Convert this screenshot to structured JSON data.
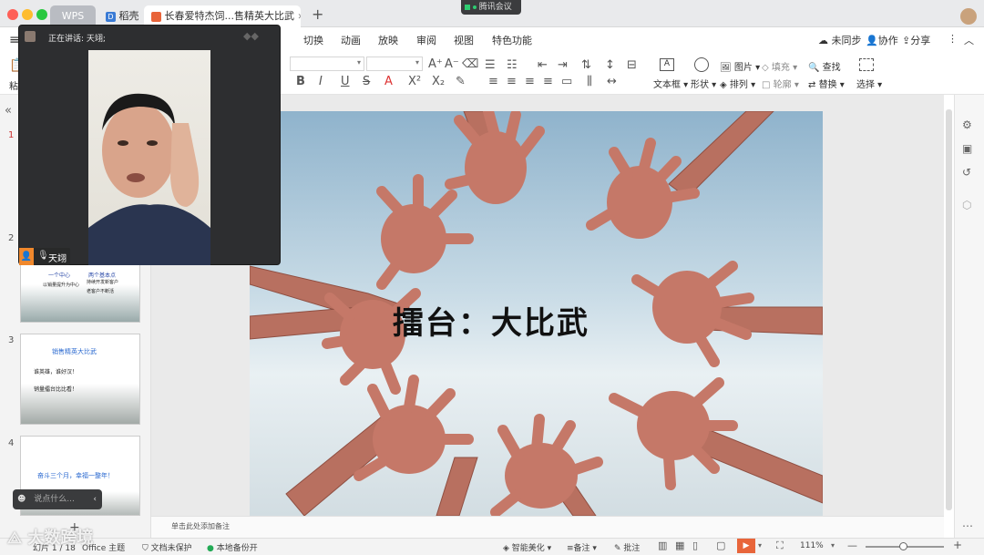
{
  "titlebar": {
    "tabs": [
      "WPS",
      "稻壳",
      "长春爱特杰饲...售精英大比武"
    ],
    "meeting_badge": "腾讯会议",
    "add_tab": "+"
  },
  "menubar": {
    "items": [
      "切换",
      "动画",
      "放映",
      "审阅",
      "视图",
      "特色功能"
    ],
    "right": [
      "未同步",
      "协作",
      "分享"
    ]
  },
  "toolbar": {
    "paste": "粘",
    "textbox": "文本框",
    "shape": "形状",
    "picture": "图片",
    "arrange": "排列",
    "fill": "填充",
    "outline": "轮廓",
    "find": "查找",
    "replace": "替换",
    "select": "选择"
  },
  "video_panel": {
    "speaking_label": "正在讲话: 天翊;",
    "participant": "天翊"
  },
  "thumbnails": [
    {
      "num": "1"
    },
    {
      "num": "2",
      "lines": [
        "一个中心",
        "两个基本点",
        "以销量提升为中心",
        "持续开发新客户",
        "老客户不断活"
      ]
    },
    {
      "num": "3",
      "lines": [
        "销售精英大比武",
        "谁英雄，谁好汉！",
        "销量擂台比比看！"
      ]
    },
    {
      "num": "4",
      "lines": [
        "奋斗三个月，幸福一整年！"
      ]
    }
  ],
  "slide": {
    "title": "擂台：大比武"
  },
  "notes": {
    "placeholder": "单击此处添加备注"
  },
  "chat": {
    "placeholder": "说点什么..."
  },
  "status": {
    "slide_count": "幻片 1 / 18",
    "theme": "Office 主题",
    "protect": "文档未保护",
    "backup": "本地备份开",
    "beautify": "智能美化",
    "notes_btn": "备注",
    "comment_btn": "批注",
    "zoom": "111%"
  },
  "watermark": "大数跨境"
}
